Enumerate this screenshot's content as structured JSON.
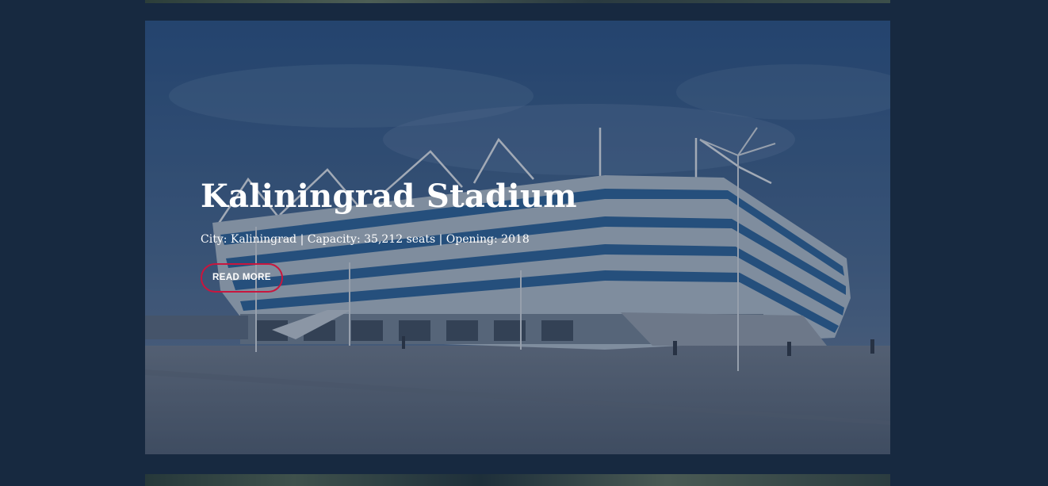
{
  "stadium": {
    "name": "Kaliningrad Stadium",
    "info": "City: Kaliningrad | Capacity: 35,212 seats | Opening: 2018",
    "cta_label": "READ MORE"
  },
  "colors": {
    "page_background": "#172940",
    "button_border": "#c8163e",
    "text": "#ffffff"
  }
}
